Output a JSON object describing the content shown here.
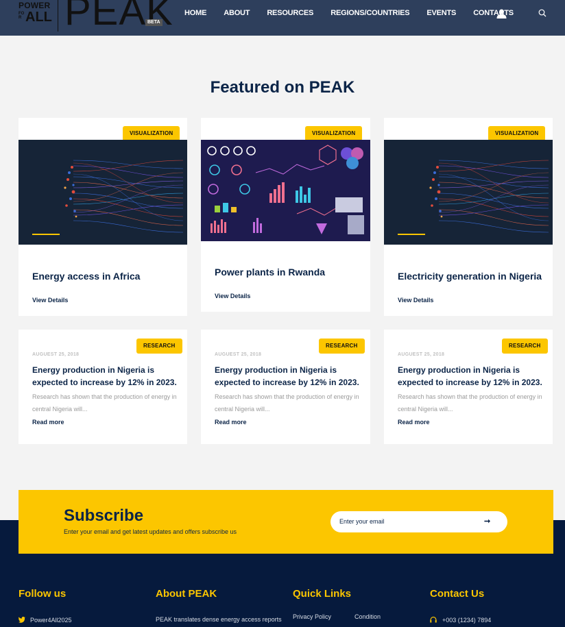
{
  "brand": {
    "power": "POWER",
    "for": "FOR",
    "all": "ALL",
    "peak": "PEAK",
    "beta": "BETA"
  },
  "nav": {
    "items": [
      "HOME",
      "ABOUT",
      "RESOURCES",
      "REGIONS/COUNTRIES",
      "EVENTS",
      "CONTACTS"
    ]
  },
  "icons": {
    "user": "user-icon",
    "search": "search-icon"
  },
  "featured": {
    "title": "Featured on PEAK",
    "cards": [
      {
        "badge": "VISUALIZATION",
        "title": "Energy access in Africa",
        "link": "View Details",
        "image": "flow-visualization"
      },
      {
        "badge": "VISUALIZATION",
        "title": "Power plants in Rwanda",
        "link": "View Details",
        "image": "dashboard-infographic"
      },
      {
        "badge": "VISUALIZATION",
        "title": "Electricity generation in Nigeria",
        "link": "View Details",
        "image": "flow-visualization"
      }
    ]
  },
  "research": {
    "cards": [
      {
        "badge": "RESEARCH",
        "date": "AUGUEST 25, 2018",
        "title": "Energy production in Nigeria is expected to increase by 12% in 2023.",
        "excerpt": "Research has shown that the production of energy in central Nigeria will...",
        "link": "Read more"
      },
      {
        "badge": "RESEARCH",
        "date": "AUGUEST 25, 2018",
        "title": "Energy production in Nigeria is expected to increase by 12% in 2023.",
        "excerpt": "Research has shown that the production of energy in central Nigeria will...",
        "link": "Read more"
      },
      {
        "badge": "RESEARCH",
        "date": "AUGUEST 25, 2018",
        "title": "Energy production in Nigeria is expected to increase by 12% in 2023.",
        "excerpt": "Research has shown that the production of energy in central Nigeria will...",
        "link": "Read more"
      }
    ]
  },
  "subscribe": {
    "title": "Subscribe",
    "text": "Enter your email and get latest updates and offers subscribe us",
    "placeholder": "Enter your email",
    "arrow": "➞"
  },
  "footer": {
    "follow": {
      "title": "Follow us",
      "twitter": "Power4All2025"
    },
    "about": {
      "title": "About PEAK",
      "text": "PEAK translates dense energy access reports"
    },
    "quick": {
      "title": "Quick Links",
      "privacy": "Privacy Policy",
      "condition": "Condition"
    },
    "contact": {
      "title": "Contact Us",
      "phone": "+003 (1234) 7894"
    }
  },
  "colors": {
    "header": "#2e3f5c",
    "accent": "#fcc600",
    "navy": "#0b2447",
    "footer": "#061a3d"
  }
}
